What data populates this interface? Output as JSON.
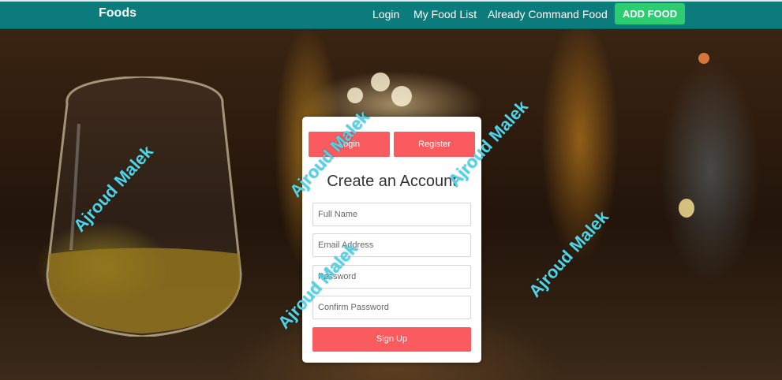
{
  "nav": {
    "brand": "Foods",
    "links": [
      {
        "label": "Login"
      },
      {
        "label": "My Food List"
      },
      {
        "label": "Already Command Food"
      }
    ],
    "add_button": "ADD FOOD"
  },
  "card": {
    "tabs": [
      {
        "label": "Login"
      },
      {
        "label": "Register"
      }
    ],
    "title": "Create an Account",
    "fields": [
      {
        "placeholder": "Full Name",
        "value": ""
      },
      {
        "placeholder": "Email Address",
        "value": ""
      },
      {
        "placeholder": "Password",
        "value": ""
      },
      {
        "placeholder": "Confirm Password",
        "value": ""
      }
    ],
    "submit": "Sign Up"
  },
  "watermark": "Ajroud Malek",
  "colors": {
    "nav_bg": "#0b7b7b",
    "add_button": "#2ecc71",
    "accent": "#f95b5f",
    "watermark": "#4fd4e6"
  }
}
